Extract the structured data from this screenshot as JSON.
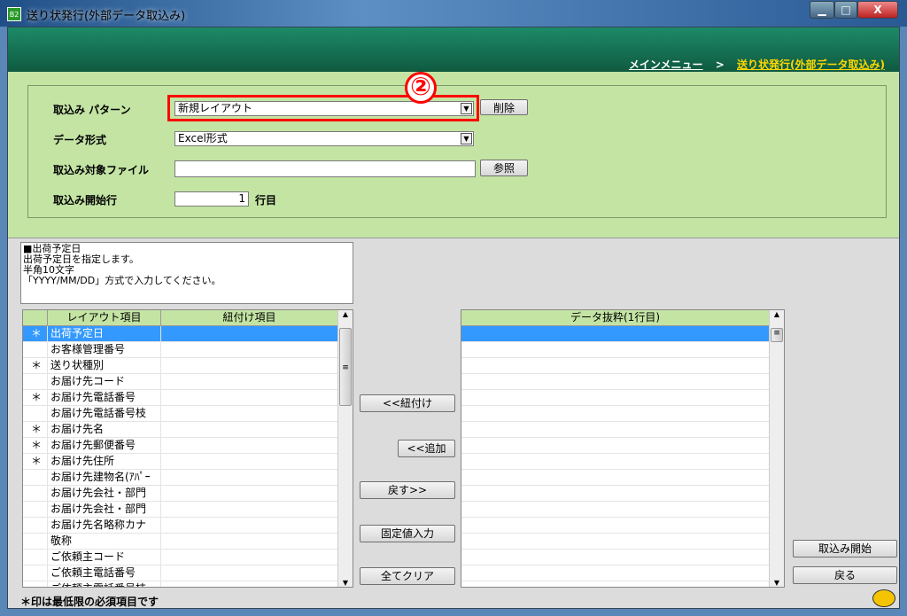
{
  "window": {
    "title": "送り状発行(外部データ取込み)",
    "icon_text": "B2",
    "minimize": "▁",
    "maximize": "□",
    "close": "X"
  },
  "breadcrumb": {
    "home": "メインメニュー",
    "sep": ">",
    "current": "送り状発行(外部データ取込み)"
  },
  "form": {
    "pattern_label": "取込み パターン",
    "pattern_value": "新規レイアウト",
    "delete_btn": "削除",
    "format_label": "データ形式",
    "format_value": "Excel形式",
    "file_label": "取込み対象ファイル",
    "file_value": "",
    "browse_btn": "参照",
    "start_label": "取込み開始行",
    "start_value": "1",
    "start_unit": "行目"
  },
  "annotation": {
    "marker": "②",
    "color": "#ff0000"
  },
  "description": "■出荷予定日\n出荷予定日を指定します。\n半角10文字\n「YYYY/MM/DD」方式で入力してください。",
  "left_grid": {
    "headers": [
      "",
      "レイアウト項目",
      "紐付け項目"
    ],
    "rows": [
      [
        "＊",
        "出荷予定日",
        ""
      ],
      [
        "",
        "お客様管理番号",
        ""
      ],
      [
        "＊",
        "送り状種別",
        ""
      ],
      [
        "",
        "お届け先コード",
        ""
      ],
      [
        "＊",
        "お届け先電話番号",
        ""
      ],
      [
        "",
        "お届け先電話番号枝",
        ""
      ],
      [
        "＊",
        "お届け先名",
        ""
      ],
      [
        "＊",
        "お届け先郵便番号",
        ""
      ],
      [
        "＊",
        "お届け先住所",
        ""
      ],
      [
        "",
        "お届け先建物名(ｱﾊﾟｰ",
        ""
      ],
      [
        "",
        "お届け先会社・部門",
        ""
      ],
      [
        "",
        "お届け先会社・部門",
        ""
      ],
      [
        "",
        "お届け先名略称カナ",
        ""
      ],
      [
        "",
        "敬称",
        ""
      ],
      [
        "",
        "ご依頼主コード",
        ""
      ],
      [
        "",
        "ご依頼主電話番号",
        ""
      ],
      [
        "",
        "ご依頼主電話番号枝",
        ""
      ]
    ]
  },
  "middle_buttons": {
    "link": "<<紐付け",
    "add": "<<追加",
    "back": "戻す>>",
    "fixed": "固定値入力",
    "clear": "全てクリア"
  },
  "right_grid": {
    "header": "データ抜粋(1行目)",
    "row_count": 17
  },
  "actions": {
    "start": "取込み開始",
    "back": "戻る"
  },
  "footer": {
    "note": "＊印は最低限の必須項目です"
  },
  "colors": {
    "header_green": "#0f5a40",
    "panel_green": "#c4e4a4",
    "selection": "#3399ff",
    "breadcrumb_link": "#ffd700"
  }
}
